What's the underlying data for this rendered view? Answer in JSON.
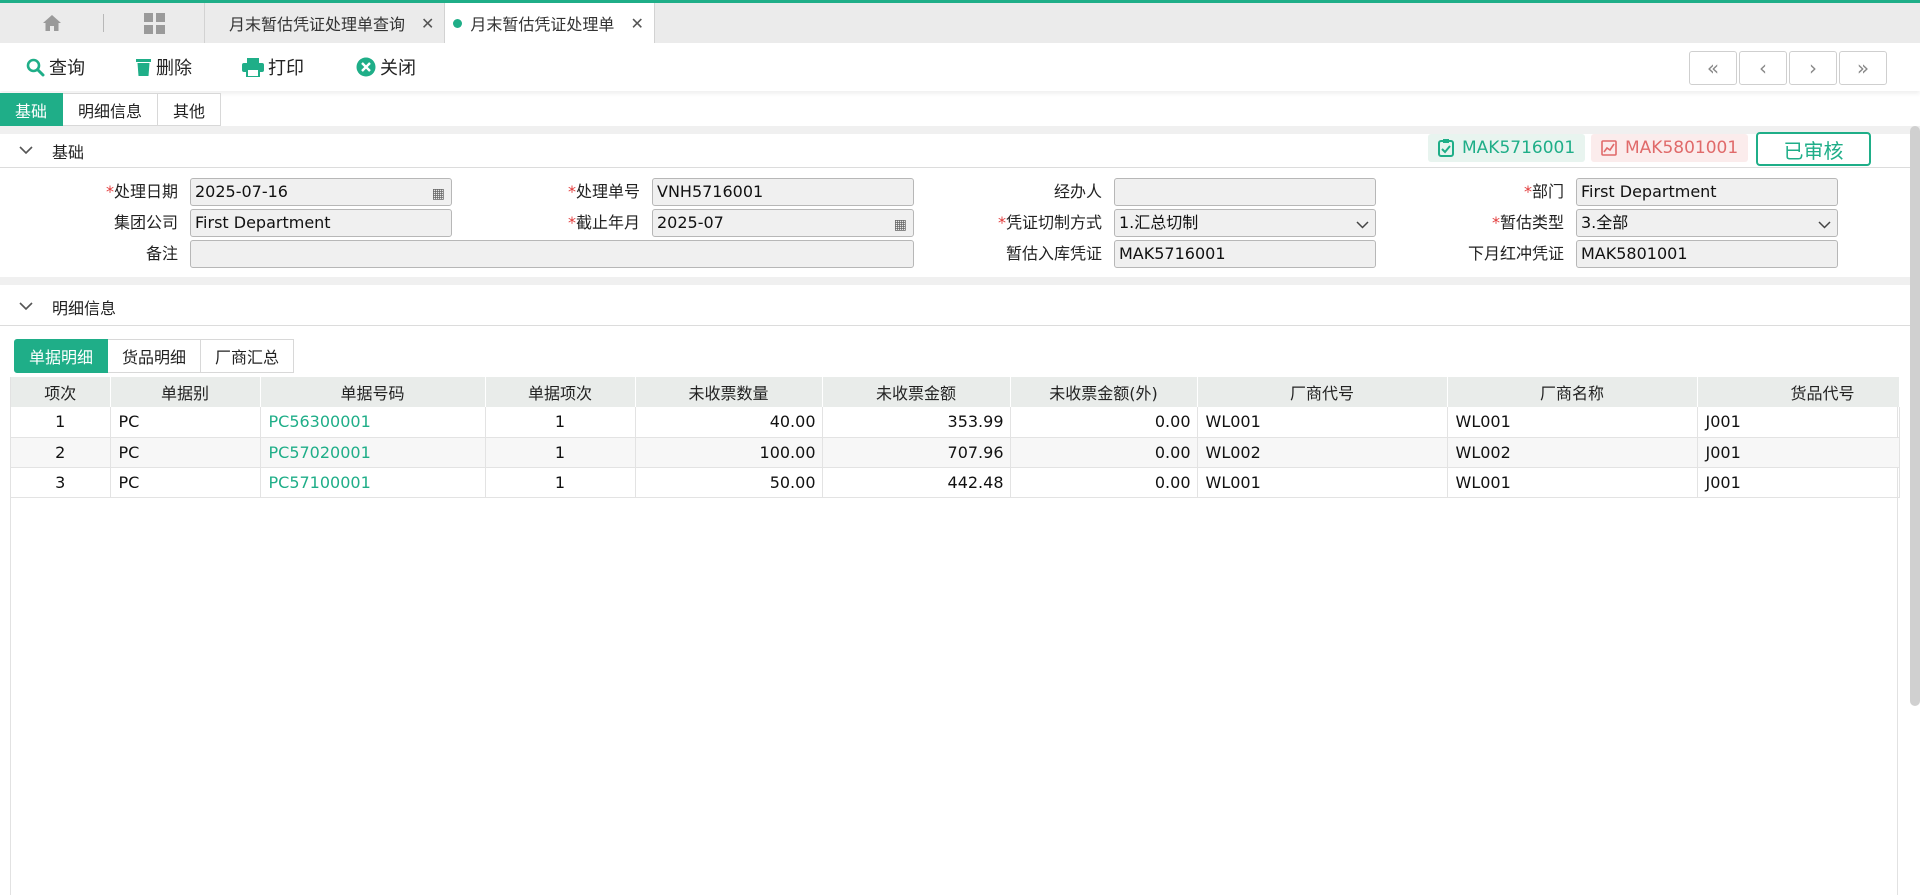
{
  "window_tabs": [
    {
      "label": "月末暂估凭证处理单查询",
      "active": false
    },
    {
      "label": "月末暂估凭证处理单",
      "active": true
    }
  ],
  "toolbar": {
    "query": "查询",
    "delete": "删除",
    "print": "打印",
    "close": "关闭"
  },
  "nav": {
    "first": "«",
    "prev": "‹",
    "next": "›",
    "last": "»"
  },
  "section_tabs": [
    "基础",
    "明细信息",
    "其他"
  ],
  "basic": {
    "title": "基础",
    "badge_green": "MAK5716001",
    "badge_red": "MAK5801001",
    "audit_status": "已审核",
    "fields": {
      "process_date": {
        "label": "处理日期",
        "value": "2025-07-16"
      },
      "process_no": {
        "label": "处理单号",
        "value": "VNH5716001"
      },
      "handler": {
        "label": "经办人",
        "value": ""
      },
      "department": {
        "label": "部门",
        "value": "First Department"
      },
      "group_company": {
        "label": "集团公司",
        "value": "First Department"
      },
      "cutoff_month": {
        "label": "截止年月",
        "value": "2025-07"
      },
      "voucher_mode": {
        "label": "凭证切制方式",
        "value": "1.汇总切制"
      },
      "estimate_type": {
        "label": "暂估类型",
        "value": "3.全部"
      },
      "remark": {
        "label": "备注",
        "value": ""
      },
      "in_voucher": {
        "label": "暂估入库凭证",
        "value": "MAK5716001"
      },
      "red_voucher": {
        "label": "下月红冲凭证",
        "value": "MAK5801001"
      }
    }
  },
  "detail": {
    "title": "明细信息",
    "sub_tabs": [
      "单据明细",
      "货品明细",
      "厂商汇总"
    ],
    "columns": [
      "项次",
      "单据别",
      "单据号码",
      "单据项次",
      "未收票数量",
      "未收票金额",
      "未收票金额(外)",
      "厂商代号",
      "厂商名称",
      "货品代号"
    ],
    "rows": [
      {
        "no": "1",
        "type": "PC",
        "doc": "PC56300001",
        "item": "1",
        "qty": "40.00",
        "amt": "353.99",
        "amt_ext": "0.00",
        "vendor_code": "WL001",
        "vendor_name": "WL001",
        "goods": "J001"
      },
      {
        "no": "2",
        "type": "PC",
        "doc": "PC57020001",
        "item": "1",
        "qty": "100.00",
        "amt": "707.96",
        "amt_ext": "0.00",
        "vendor_code": "WL002",
        "vendor_name": "WL002",
        "goods": "J001"
      },
      {
        "no": "3",
        "type": "PC",
        "doc": "PC57100001",
        "item": "1",
        "qty": "50.00",
        "amt": "442.48",
        "amt_ext": "0.00",
        "vendor_code": "WL001",
        "vendor_name": "WL001",
        "goods": "J001"
      }
    ]
  },
  "colors": {
    "accent": "#1fae88",
    "danger": "#e06a6a",
    "required": "#e23b3b"
  }
}
